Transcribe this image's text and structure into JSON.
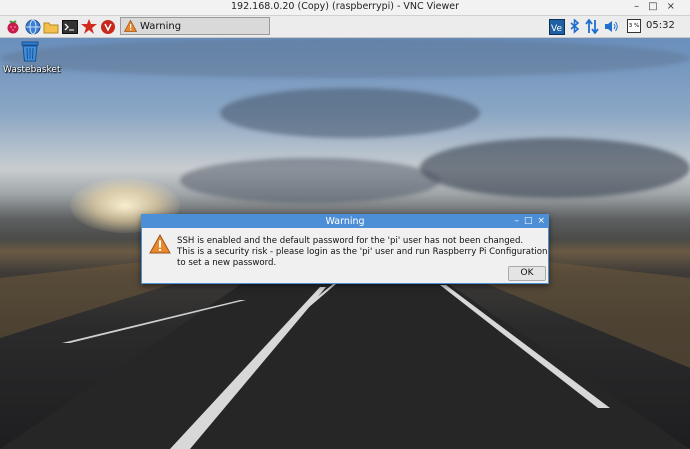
{
  "window": {
    "title": "192.168.0.20 (Copy) (raspberrypi) - VNC Viewer",
    "controls": [
      "–",
      "□",
      "×"
    ]
  },
  "panel": {
    "launchers": [
      "raspberry-menu-icon",
      "web-browser-icon",
      "file-manager-icon",
      "terminal-icon",
      "mathematica-icon",
      "wolfram-icon"
    ],
    "taskbar": [
      {
        "label": "Warning",
        "icon": "warning-icon"
      }
    ],
    "tray": {
      "icons": [
        "vnc-server-icon",
        "bluetooth-icon",
        "network-icon",
        "volume-icon"
      ],
      "cpu_label": "3 %",
      "clock": "05:32"
    }
  },
  "desktop": {
    "icons": [
      {
        "label": "Wastebasket",
        "icon": "wastebasket-icon"
      }
    ]
  },
  "dialog": {
    "title": "Warning",
    "controls": [
      "–",
      "□",
      "×"
    ],
    "message_line1": "SSH is enabled and the default password for the 'pi' user has not been changed.",
    "message_line2": "This is a security risk - please login as the 'pi' user and run Raspberry Pi Configuration to set a new password.",
    "ok_label": "OK"
  },
  "colors": {
    "accent": "#4d8fd6",
    "panel": "#ececec",
    "warning": "#e8892d"
  }
}
